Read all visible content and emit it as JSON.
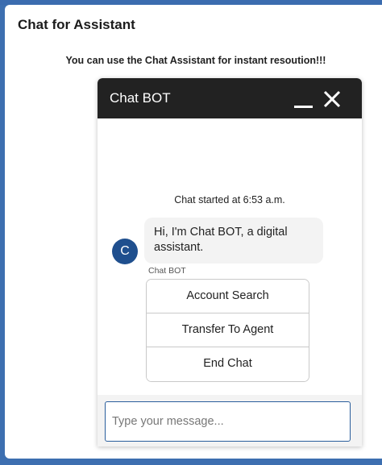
{
  "page": {
    "title": "Chat for Assistant",
    "subtitle": "You can use the Chat Assistant for instant resoution!!!"
  },
  "chat": {
    "header_title": "Chat BOT",
    "minimize_icon": "minimize-icon",
    "close_icon": "close-icon",
    "started_text": "Chat started at 6:53 a.m.",
    "avatar_initial": "C",
    "bot_message": "Hi, I'm Chat BOT, a digital assistant.",
    "sender_label": "Chat BOT",
    "options": [
      {
        "label": "Account Search"
      },
      {
        "label": "Transfer To Agent"
      },
      {
        "label": "End Chat"
      }
    ],
    "input_placeholder": "Type your message...",
    "input_value": ""
  },
  "colors": {
    "header_bg": "#222222",
    "avatar_bg": "#1f4f8e",
    "page_border": "#3d6fb0",
    "input_border": "#2a5e9c"
  }
}
